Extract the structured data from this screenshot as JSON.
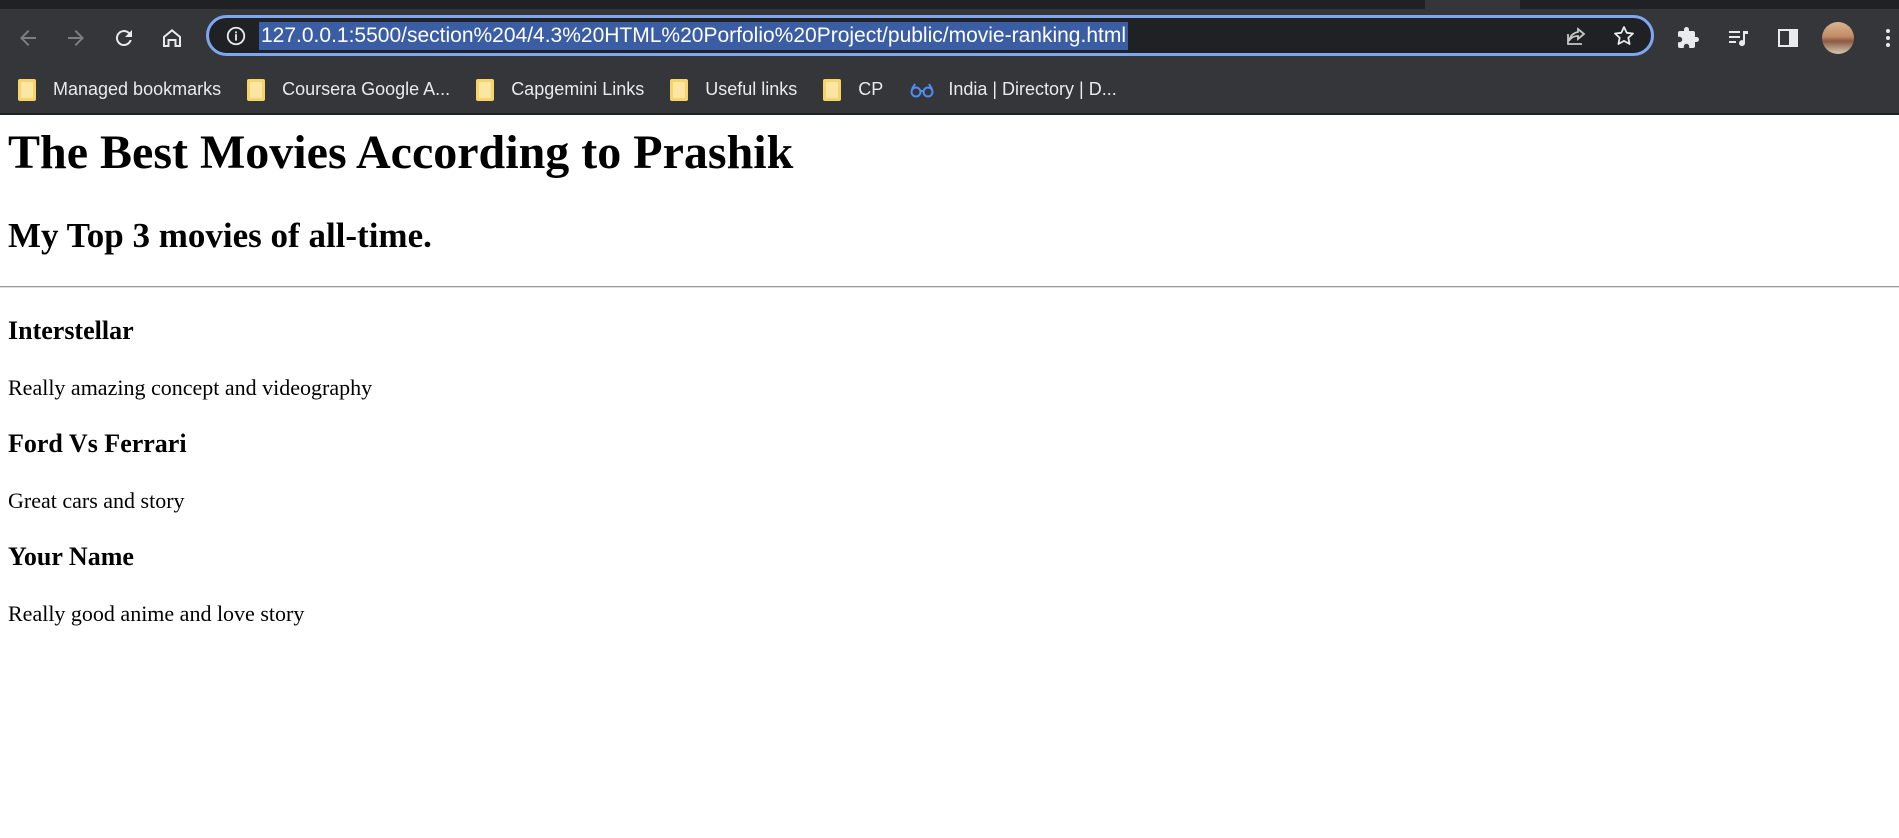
{
  "browser": {
    "url": "127.0.0.1:5500/section%204/4.3%20HTML%20Porfolio%20Project/public/movie-ranking.html",
    "bookmarks": [
      {
        "label": "Managed bookmarks",
        "icon": "folder-icon"
      },
      {
        "label": "Coursera Google A...",
        "icon": "folder-icon"
      },
      {
        "label": "Capgemini Links",
        "icon": "folder-icon"
      },
      {
        "label": "Useful links",
        "icon": "folder-icon"
      },
      {
        "label": "CP",
        "icon": "folder-icon"
      },
      {
        "label": "India | Directory | D...",
        "icon": "glasses-icon"
      }
    ]
  },
  "page": {
    "title": "The Best Movies According to Prashik",
    "subtitle": "My Top 3 movies of all-time.",
    "movies": [
      {
        "name": "Interstellar",
        "review": "Really amazing concept and videography"
      },
      {
        "name": "Ford Vs Ferrari",
        "review": "Great cars and story"
      },
      {
        "name": "Your Name",
        "review": "Really good anime and love story"
      }
    ]
  }
}
